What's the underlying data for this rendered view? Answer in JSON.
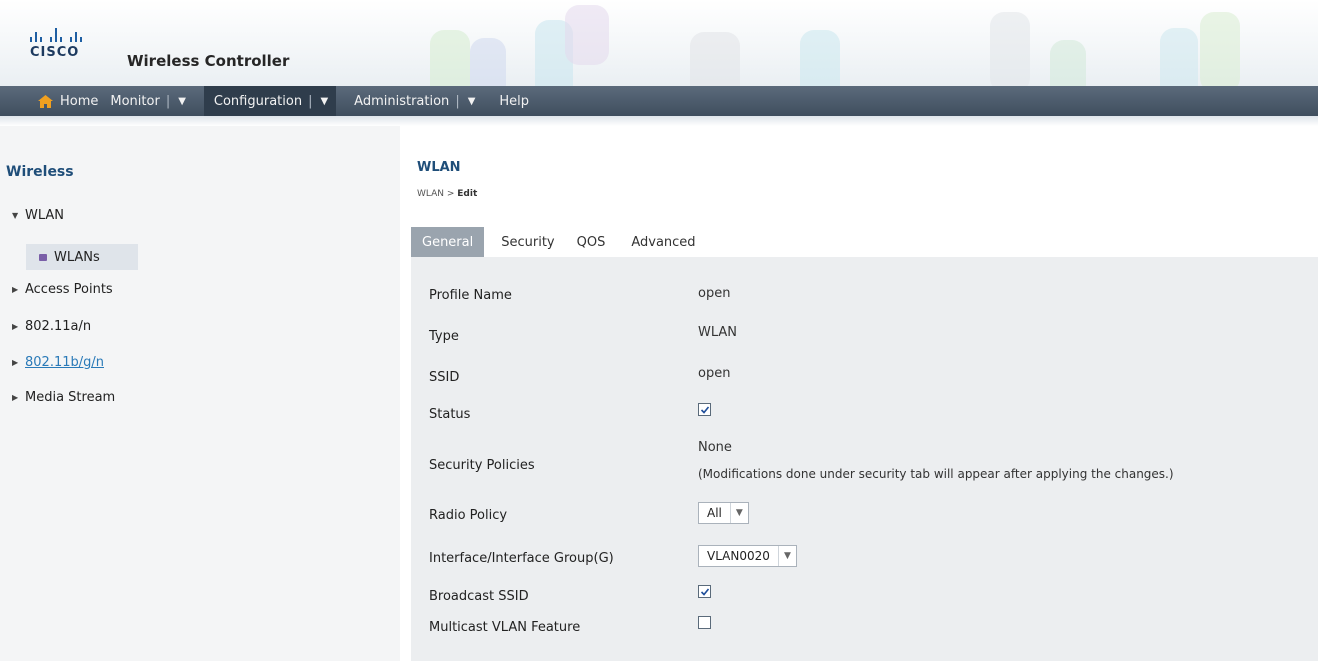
{
  "header": {
    "logo_text": "CISCO",
    "app_title": "Wireless Controller"
  },
  "nav": {
    "items": [
      {
        "label": "Home",
        "icon": "home-icon"
      },
      {
        "label": "Monitor"
      },
      {
        "label": "Configuration"
      },
      {
        "label": "Administration"
      },
      {
        "label": "Help"
      }
    ],
    "separator": "|",
    "dropdown_glyph": "▼"
  },
  "sidebar": {
    "title": "Wireless",
    "items": [
      {
        "label": "WLAN"
      },
      {
        "label": "WLANs"
      },
      {
        "label": "Access Points"
      },
      {
        "label": "802.11a/n"
      },
      {
        "label": "802.11b/g/n"
      },
      {
        "label": "Media Stream"
      }
    ]
  },
  "main": {
    "title": "WLAN",
    "breadcrumb": {
      "root": "WLAN",
      "sep": " > ",
      "current": "Edit"
    },
    "tabs": [
      {
        "label": "General"
      },
      {
        "label": "Security"
      },
      {
        "label": "QOS"
      },
      {
        "label": "Advanced"
      }
    ],
    "fields": {
      "profile_name": {
        "label": "Profile Name",
        "value": "open"
      },
      "type": {
        "label": "Type",
        "value": "WLAN"
      },
      "ssid": {
        "label": "SSID",
        "value": "open"
      },
      "status": {
        "label": "Status",
        "checked": true
      },
      "security_policies": {
        "label": "Security Policies",
        "value": "None",
        "note": "(Modifications done under security tab will appear after applying the changes.)"
      },
      "radio_policy": {
        "label": "Radio Policy",
        "value": "All"
      },
      "interface": {
        "label": "Interface/Interface Group(G)",
        "value": "VLAN0020"
      },
      "broadcast_ssid": {
        "label": "Broadcast SSID",
        "checked": true
      },
      "multicast_vlan": {
        "label": "Multicast VLAN Feature",
        "checked": false
      }
    }
  },
  "colors": {
    "nav_bg": "#4a5969",
    "nav_active": "#2f3d4c",
    "title_blue": "#1f4e79",
    "panel_bg": "#eceef0",
    "tab_active": "#9aa4ae"
  }
}
